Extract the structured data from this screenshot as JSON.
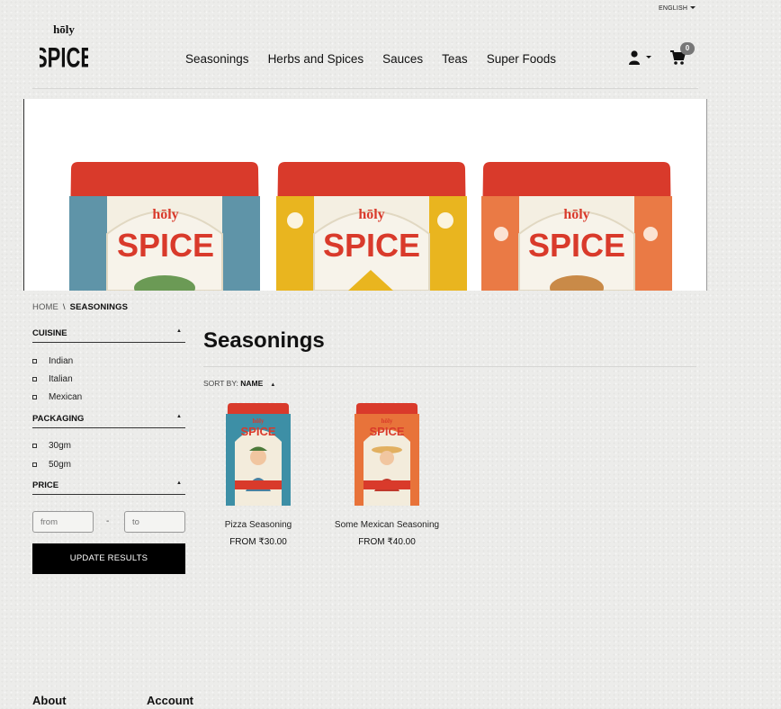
{
  "header": {
    "language": "ENGLISH",
    "logo_alt": "holy SPICE",
    "nav": [
      "Seasonings",
      "Herbs and Spices",
      "Sauces",
      "Teas",
      "Super Foods"
    ],
    "cart_count": "0"
  },
  "banner": {
    "brand_text": "SPICE",
    "brand_small": "holy"
  },
  "breadcrumb": {
    "home": "HOME",
    "separator": "\\",
    "current": "SEASONINGS"
  },
  "filters": {
    "cuisine": {
      "label": "CUISINE",
      "options": [
        "Indian",
        "Italian",
        "Mexican"
      ]
    },
    "packaging": {
      "label": "PACKAGING",
      "options": [
        "30gm",
        "50gm"
      ]
    },
    "price": {
      "label": "PRICE",
      "from_placeholder": "from",
      "to_placeholder": "to",
      "separator": "-"
    },
    "update_label": "UPDATE RESULTS"
  },
  "main": {
    "title": "Seasonings",
    "sort_label": "SORT BY:",
    "sort_value": "NAME",
    "products": [
      {
        "name": "Pizza Seasoning",
        "price": "FROM ₹30.00",
        "color": "#3d8fa6"
      },
      {
        "name": "Some Mexican Seasoning",
        "price": "FROM ₹40.00",
        "color": "#e8733a"
      }
    ]
  },
  "footer": {
    "col1": "About",
    "col2": "Account"
  }
}
